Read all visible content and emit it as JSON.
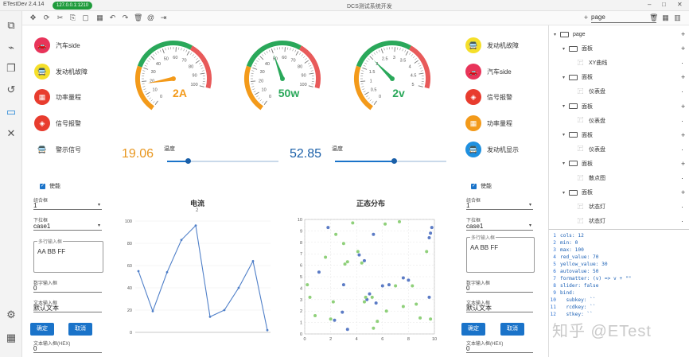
{
  "app": {
    "title": "ETestDev 2.4.14",
    "ip": "127.0.0.1:1210",
    "doc_title": "DCS测试系统开发"
  },
  "toolbar": {
    "page_label": "page"
  },
  "left_status": [
    {
      "label": "汽车side",
      "color": "#e8345a",
      "icon": "🚗"
    },
    {
      "label": "发动机故障",
      "color": "#f5df2a",
      "icon": "🚍"
    },
    {
      "label": "功率量程",
      "color": "#e83c2e",
      "icon": "▦"
    },
    {
      "label": "信号报警",
      "color": "#e83c2e",
      "icon": "◈"
    },
    {
      "label": "警示信号",
      "color": "#ffffff",
      "icon": "🚍"
    }
  ],
  "right_status": [
    {
      "label": "发动机故障",
      "color": "#f5df2a",
      "icon": "🚍"
    },
    {
      "label": "汽车side",
      "color": "#e8345a",
      "icon": "🚗"
    },
    {
      "label": "信号报警",
      "color": "#e83c2e",
      "icon": "◈"
    },
    {
      "label": "功率量程",
      "color": "#f39a1a",
      "icon": "▦"
    },
    {
      "label": "发动机显示",
      "color": "#1e90e0",
      "icon": "🚍"
    }
  ],
  "gauges": [
    {
      "value": "2A",
      "min": 0,
      "max": 100,
      "needle": 18,
      "color": "#f39a1a",
      "ticks": [
        "0",
        "10",
        "20",
        "30",
        "40",
        "50",
        "60",
        "70",
        "80",
        "90",
        "100"
      ]
    },
    {
      "value": "50w",
      "min": 0,
      "max": 100,
      "needle": 50,
      "color": "#2aa85a",
      "ticks": [
        "0",
        "10",
        "20",
        "30",
        "40",
        "50",
        "60",
        "70",
        "80",
        "90",
        "100"
      ]
    },
    {
      "value": "2v",
      "min": 0,
      "max": 5,
      "needle": 2,
      "color": "#2aa85a",
      "ticks": [
        "0",
        "0.5",
        "1",
        "1.5",
        "2",
        "2.5",
        "3",
        "3.5",
        "4",
        "4.5",
        "5"
      ]
    }
  ],
  "sliders": [
    {
      "label": "温度",
      "number": "19.06",
      "color": "#e8961e",
      "fraction": 0.19
    },
    {
      "label": "温度",
      "number": "52.85",
      "color": "#1a5fa8",
      "fraction": 0.53
    }
  ],
  "form_left": {
    "enable": "使能",
    "combo_label": "组合框",
    "combo_value": "1",
    "dropdown_label": "下拉框",
    "dropdown_value": "case1",
    "multiline_label": "多行输入框",
    "multiline_value": "AA BB FF",
    "num_label": "数字输入框",
    "num_value": "0",
    "text_label": "文本输入框",
    "text_value": "默认文本",
    "ok": "确定",
    "cancel": "取消",
    "hex_label": "文本输入框(HEX)",
    "hex_value": "0"
  },
  "form_right": {
    "enable": "使能",
    "combo_label": "组合框",
    "combo_value": "1",
    "dropdown_label": "下拉框",
    "dropdown_value": "case1",
    "multiline_label": "多行输入框",
    "multiline_value": "AA BB FF",
    "num_label": "数字输入框",
    "num_value": "0",
    "text_label": "文本输入框",
    "text_value": "默认文本",
    "ok": "确定",
    "cancel": "取消",
    "hex_label": "文本输入框(HEX)",
    "hex_value": "0"
  },
  "chart_data": [
    {
      "type": "line",
      "title": "电流",
      "subtitle": "2",
      "ylim": [
        0,
        100
      ],
      "yticks": [
        "100",
        "80",
        "60",
        "40",
        "20",
        "0"
      ],
      "x": [
        0,
        1,
        2,
        3,
        4,
        5,
        6,
        7,
        8,
        9
      ],
      "series": [
        {
          "values": [
            55,
            19,
            54,
            83,
            96,
            14,
            20,
            40,
            64,
            2
          ]
        }
      ]
    },
    {
      "type": "scatter",
      "title": "正态分布",
      "xlim": [
        0,
        10
      ],
      "ylim": [
        0,
        10
      ],
      "xticks": [
        "0",
        "2",
        "4",
        "6",
        "8",
        "10"
      ],
      "yticks": [
        "10",
        "9",
        "8",
        "7",
        "6",
        "5",
        "4",
        "3",
        "2",
        "1",
        "0"
      ],
      "series": [
        {
          "color": "#5b7bc5",
          "points": [
            [
              1.8,
              9.3
            ],
            [
              1.1,
              5.4
            ],
            [
              2.9,
              1.9
            ],
            [
              3.0,
              4.3
            ],
            [
              3.3,
              0.4
            ],
            [
              4.2,
              6.9
            ],
            [
              4.6,
              6.4
            ],
            [
              4.8,
              3.0
            ],
            [
              5.3,
              8.7
            ],
            [
              5.0,
              3.5
            ],
            [
              5.5,
              2.7
            ],
            [
              6.5,
              4.3
            ],
            [
              7.6,
              4.9
            ],
            [
              8.0,
              4.7
            ],
            [
              9.6,
              8.4
            ],
            [
              9.7,
              8.8
            ],
            [
              9.8,
              9.3
            ],
            [
              9.6,
              3.2
            ],
            [
              6.0,
              4.2
            ],
            [
              2.3,
              1.2
            ]
          ]
        },
        {
          "color": "#8fd07a",
          "points": [
            [
              0.2,
              4.3
            ],
            [
              0.4,
              3.2
            ],
            [
              0.8,
              1.6
            ],
            [
              2.0,
              1.3
            ],
            [
              2.2,
              2.8
            ],
            [
              2.4,
              8.7
            ],
            [
              3.0,
              7.9
            ],
            [
              3.1,
              6.1
            ],
            [
              3.3,
              6.3
            ],
            [
              3.7,
              9.7
            ],
            [
              4.4,
              6.2
            ],
            [
              4.6,
              2.8
            ],
            [
              4.1,
              7.2
            ],
            [
              4.7,
              3.2
            ],
            [
              5.2,
              3.2
            ],
            [
              5.3,
              0.5
            ],
            [
              5.6,
              1.1
            ],
            [
              6.2,
              9.6
            ],
            [
              7.0,
              4.2
            ],
            [
              7.3,
              9.8
            ],
            [
              7.6,
              2.4
            ],
            [
              8.3,
              4.2
            ],
            [
              8.6,
              2.6
            ],
            [
              8.9,
              1.4
            ],
            [
              9.7,
              1.3
            ],
            [
              9.4,
              7.2
            ],
            [
              1.6,
              6.7
            ],
            [
              6.3,
              2.0
            ]
          ]
        }
      ]
    }
  ],
  "tree": [
    {
      "label": "page",
      "level": 0,
      "kind": "folder"
    },
    {
      "label": "面板",
      "level": 1,
      "kind": "folder"
    },
    {
      "label": "XY曲线",
      "level": 2,
      "kind": "comp"
    },
    {
      "label": "面板",
      "level": 1,
      "kind": "folder"
    },
    {
      "label": "仪表盘",
      "level": 2,
      "kind": "comp"
    },
    {
      "label": "面板",
      "level": 1,
      "kind": "folder"
    },
    {
      "label": "仪表盘",
      "level": 2,
      "kind": "comp"
    },
    {
      "label": "面板",
      "level": 1,
      "kind": "folder"
    },
    {
      "label": "仪表盘",
      "level": 2,
      "kind": "comp"
    },
    {
      "label": "面板",
      "level": 1,
      "kind": "folder"
    },
    {
      "label": "散点图",
      "level": 2,
      "kind": "comp"
    },
    {
      "label": "面板",
      "level": 1,
      "kind": "folder"
    },
    {
      "label": "状态灯",
      "level": 2,
      "kind": "comp"
    },
    {
      "label": "状态灯",
      "level": 2,
      "kind": "comp"
    }
  ],
  "code_lines": [
    "cols: 12",
    "min: 0",
    "max: 100",
    "red_value: 70",
    "yellow_value: 30",
    "autovalue: 50",
    "formatter: (v) => v + \"\"",
    "slider: false",
    "bind:",
    "  subkey: ``",
    "  rcdkey: ``",
    "  stkey: ``"
  ],
  "watermark": "知乎 @ETest"
}
